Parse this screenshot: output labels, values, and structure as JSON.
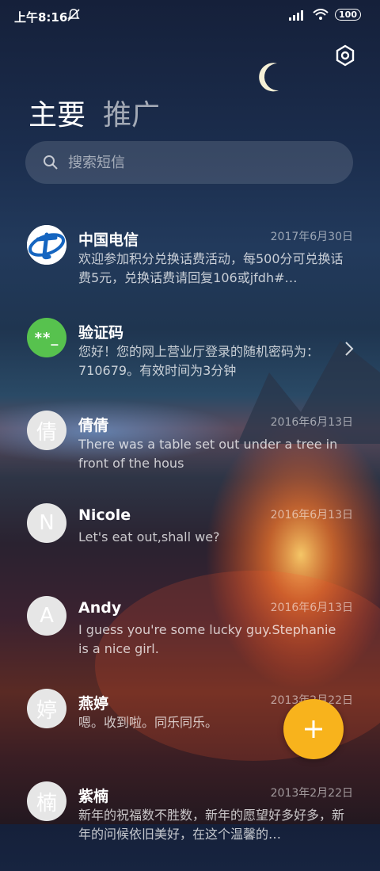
{
  "status_bar": {
    "time": "上午8:16",
    "battery": "100"
  },
  "tabs": {
    "primary": "主要",
    "promotions": "推广"
  },
  "search": {
    "placeholder": "搜索短信"
  },
  "conversations": [
    {
      "avatar_type": "telecom-logo",
      "avatar_text": "",
      "name": "中国电信",
      "date": "2017年6月30日",
      "preview": "欢迎参加积分兑换话费活动，每500分可兑换话费5元，兑换话费请回复106或jfdh#…",
      "has_chevron": false
    },
    {
      "avatar_type": "code",
      "avatar_text": "**_",
      "name": "验证码",
      "date": "",
      "preview": "您好！您的网上营业厅登录的随机密码为：710679。有效时间为3分钟",
      "has_chevron": true
    },
    {
      "avatar_type": "letter",
      "avatar_text": "倩",
      "name": "倩倩",
      "date": "2016年6月13日",
      "preview": "There was a table set out under a tree in front of the hous",
      "has_chevron": false
    },
    {
      "avatar_type": "letter",
      "avatar_text": "N",
      "name": "Nicole",
      "date": "2016年6月13日",
      "preview": "Let's eat out,shall we?",
      "has_chevron": false
    },
    {
      "avatar_type": "letter",
      "avatar_text": "A",
      "name": "Andy",
      "date": "2016年6月13日",
      "preview": "I guess you're some lucky guy.Stephanie is a nice girl.",
      "has_chevron": false
    },
    {
      "avatar_type": "letter",
      "avatar_text": "婷",
      "name": "燕婷",
      "date": "2013年2月22日",
      "preview": "嗯。收到啦。同乐同乐。",
      "has_chevron": false
    },
    {
      "avatar_type": "letter",
      "avatar_text": "楠",
      "name": "紫楠",
      "date": "2013年2月22日",
      "preview": "新年的祝福数不胜数，新年的愿望好多好多，新年的问候依旧美好，在这个温馨的…",
      "has_chevron": false
    }
  ],
  "colors": {
    "fab": "#f8b31c",
    "code_avatar": "#57c24e",
    "telecom_blue": "#1565c0"
  },
  "icons": {
    "settings": "hexagon-gear-icon",
    "search": "search-icon",
    "fab": "plus-icon",
    "mute": "bell-off-icon"
  }
}
